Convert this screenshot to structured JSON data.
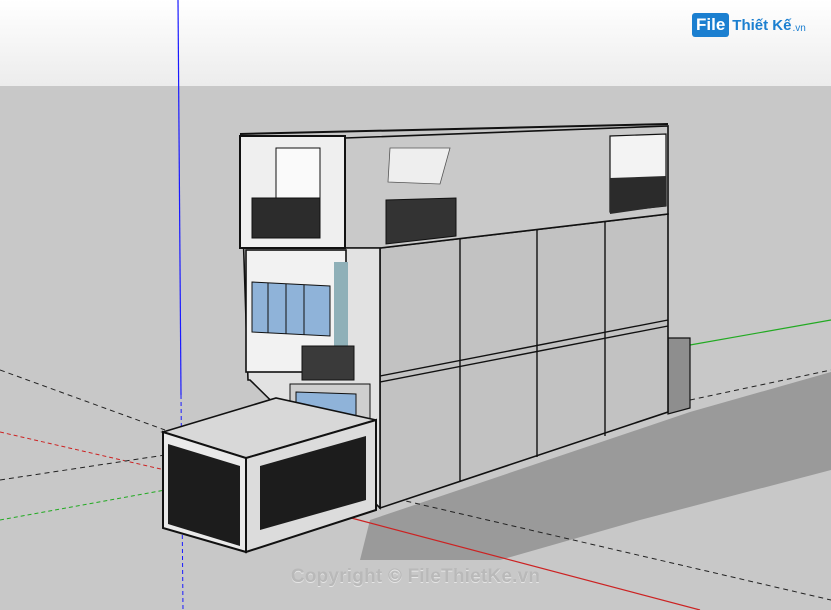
{
  "watermark": {
    "logo_file": "File",
    "logo_name": "Thiết Kế",
    "logo_domain": ".vn",
    "copyright": "Copyright © FileThietKe.vn"
  },
  "colors": {
    "sky_top": "#ffffff",
    "ground": "#c8c8c8",
    "axis_blue": "#1a1aff",
    "axis_red": "#cc2222",
    "axis_green": "#22aa22",
    "wall_front": "#dcdcdc",
    "wall_side": "#a8a8a8",
    "glass": "#8fb3d9",
    "brand_blue": "#1b7fd0"
  }
}
